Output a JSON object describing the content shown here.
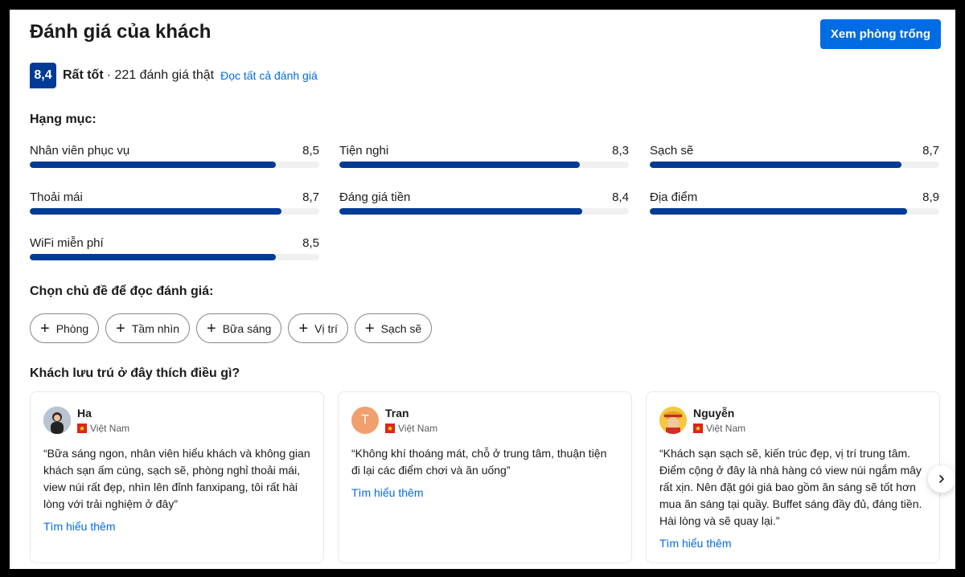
{
  "header": {
    "title": "Đánh giá của khách",
    "cta_label": "Xem phòng trống"
  },
  "score": {
    "value": "8,4",
    "word": "Rất tốt",
    "count_text": "· 221 đánh giá thật",
    "read_all_link": "Đọc tất cả đánh giá"
  },
  "categories": {
    "title": "Hạng mục:",
    "items": [
      {
        "label": "Nhân viên phục vụ",
        "score": "8,5",
        "value": 8.5
      },
      {
        "label": "Tiện nghi",
        "score": "8,3",
        "value": 8.3
      },
      {
        "label": "Sạch sẽ",
        "score": "8,7",
        "value": 8.7
      },
      {
        "label": "Thoải mái",
        "score": "8,7",
        "value": 8.7
      },
      {
        "label": "Đáng giá tiền",
        "score": "8,4",
        "value": 8.4
      },
      {
        "label": "Địa điểm",
        "score": "8,9",
        "value": 8.9
      },
      {
        "label": "WiFi miễn phí",
        "score": "8,5",
        "value": 8.5
      }
    ]
  },
  "topics": {
    "title": "Chọn chủ đề để đọc đánh giá:",
    "chips": [
      "Phòng",
      "Tầm nhìn",
      "Bữa sáng",
      "Vị trí",
      "Sạch sẽ"
    ]
  },
  "liked": {
    "title": "Khách lưu trú ở đây thích điều gì?",
    "reviews": [
      {
        "name": "Ha",
        "country": "Việt Nam",
        "quote": "“Bữa sáng ngon, nhân viên hiểu khách và không gian khách sạn ấm cúng, sạch sẽ, phòng nghỉ thoải mái, view núi rất đẹp, nhìn lên đỉnh fanxipang, tôi rất hài lòng với trải nghiệm ở đây”",
        "more": "Tìm hiểu thêm"
      },
      {
        "name": "Tran",
        "initial": "T",
        "country": "Việt Nam",
        "quote": "“Không khí thoáng mát, chỗ ở trung tâm, thuận tiện đi lại các điểm chơi và ăn uống”",
        "more": "Tìm hiểu thêm"
      },
      {
        "name": "Nguyễn",
        "country": "Việt Nam",
        "quote": "“Khách sạn sạch sẽ, kiến trúc đẹp, vị trí trung tâm. Điểm cộng ở đây là nhà hàng có view núi ngắm mây rất xịn. Nên đặt gói giá bao gồm ăn sáng sẽ tốt hơn mua ăn sáng tại quầy. Buffet sáng đầy đủ, đáng tiền. Hài lòng và sẽ quay lại.”",
        "more": "Tìm hiểu thêm"
      }
    ]
  },
  "colors": {
    "brand": "#003b95",
    "accent": "#006ce4",
    "initial_avatar": "#f0a06e"
  },
  "icons": {
    "chip": "plus-icon",
    "next": "chevron-right-icon",
    "flag": "vietnam-flag-icon"
  }
}
